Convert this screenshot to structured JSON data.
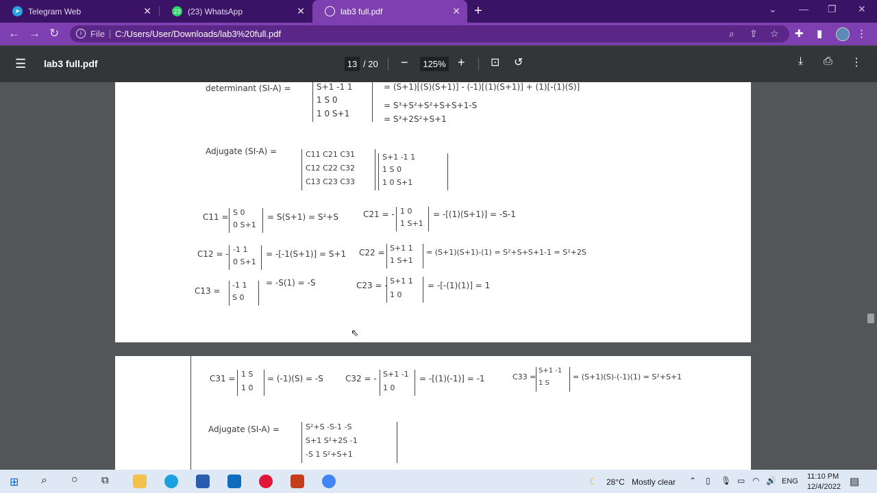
{
  "tabs": [
    {
      "label": "Telegram Web",
      "color": "#2aa3df"
    },
    {
      "label": "(23) WhatsApp",
      "color": "#25d366",
      "badge": "23"
    },
    {
      "label": "lab3 full.pdf",
      "color": "#ffffff"
    }
  ],
  "address": {
    "file_label": "File",
    "url": "C:/Users/User/Downloads/lab3%20full.pdf"
  },
  "pdf": {
    "title": "lab3 full.pdf",
    "page_current": "13",
    "page_total": "/ 20",
    "zoom": "125%"
  },
  "notes": {
    "det_label": "determinant (SI-A) =",
    "det_m": [
      "S+1  -1   1",
      "1   S   0",
      "1   0   S+1"
    ],
    "det_r1": "= (S+1)[(S)(S+1)] - (-1)[(1)(S+1)] + (1)[-(1)(S)]",
    "det_r2": "= S³+S²+S²+S+S+1-S",
    "det_r3": "= S³+2S²+S+1",
    "adj_label": "Adjugate (SI-A) =",
    "adj_c": [
      "C11  C21  C31",
      "C12  C22  C32",
      "C13  C23  C33"
    ],
    "adj_m": [
      "S+1  -1   1",
      "1    S   0",
      "1    0   S+1"
    ],
    "c11": "C11 =",
    "c11_m": [
      "S   0",
      "0  S+1"
    ],
    "c11_r": "= S(S+1) = S²+S",
    "c21": "C21 = -",
    "c21_m": [
      "1   0",
      "1  S+1"
    ],
    "c21_r": "= -[(1)(S+1)] = -S-1",
    "c12": "C12 = -",
    "c12_m": [
      "-1   1",
      "0  S+1"
    ],
    "c12_r": "= -[-1(S+1)] = S+1",
    "c22": "C22 =",
    "c22_m": [
      "S+1   1",
      "1   S+1"
    ],
    "c22_r": "= (S+1)(S+1)-(1) = S²+S+S+1-1 = S²+2S",
    "c13": "C13 =",
    "c13_m": [
      "-1   1",
      "S   0"
    ],
    "c13_r": "= -S(1) = -S",
    "c23": "C23 = -",
    "c23_m": [
      "S+1   1",
      "1    0"
    ],
    "c23_r": "= -[-(1)(1)] = 1",
    "c31": "C31 =",
    "c31_m": [
      "1   S",
      "1   0"
    ],
    "c31_r": "= (-1)(S) = -S",
    "c32": "C32 = -",
    "c32_m": [
      "S+1  -1",
      "1    0"
    ],
    "c32_r": "= -[(1)(-1)] = -1",
    "c33": "C33 =",
    "c33_m": [
      "S+1  -1",
      "1    S"
    ],
    "c33_r": "= (S+1)(S)-(-1)(1) = S²+S+1",
    "adj2_label": "Adjugate (SI-A) =",
    "adj2_m": [
      "S²+S   -S-1   -S",
      "S+1   S²+2S   -1",
      "-S      1    S²+S+1"
    ]
  },
  "taskbar": {
    "weather": "28°C",
    "weather_desc": "Mostly clear",
    "lang": "ENG",
    "time": "11:10 PM",
    "date": "12/4/2022"
  }
}
